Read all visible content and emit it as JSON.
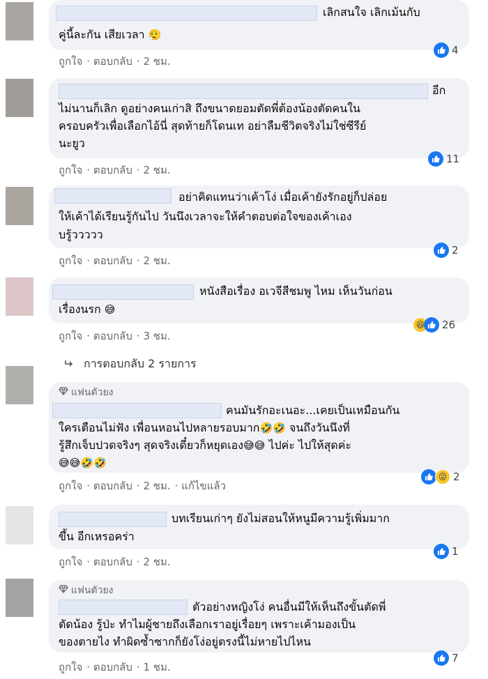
{
  "comments": [
    {
      "lines": [
        "เลิกสนใจ เลิกเม้นกับ",
        "คู่นี้ละกัน เสียเวลา"
      ],
      "emoji": "😮‍💨",
      "actions": [
        "ถูกใจ",
        "ตอบกลับ",
        "2 ชม."
      ],
      "reactions_count": "4"
    },
    {
      "lines": [
        "อีก",
        "ไม่นานก็เลิก ดูอย่างคนเก่าสิ ถึงขนาดยอมตัดพี่ต้องน้องตัดคนใน",
        "ครอบครัวเพื่อเลือกไอ้นี่ สุดท้ายก็โดนเท อย่าลืมชีวิตจริงไม่ใช่ซีรีย์",
        "นะยูว"
      ],
      "actions": [
        "ถูกใจ",
        "ตอบกลับ",
        "2 ชม."
      ],
      "reactions_count": "11"
    },
    {
      "lines": [
        "อย่าคิดแทนว่าเค้าโง่ เมื่อเค้ายังรักอยู่ก็ปล่อย",
        "ให้เค้าได้เรียนรู้กันไป วันนึงเวลาจะให้คำตอบต่อใจของเค้าเอง",
        "บรู้ววววว"
      ],
      "actions": [
        "ถูกใจ",
        "ตอบกลับ",
        "2 ชม."
      ],
      "reactions_count": "2"
    },
    {
      "lines": [
        "หนังสือเรื่อง อเวจีสีชมพู ไหม เห็นวันก่อน",
        "เรื่องนรก"
      ],
      "emoji": "😅",
      "actions": [
        "ถูกใจ",
        "ตอบกลับ",
        "3 ชม."
      ],
      "reactions_count": "26"
    },
    {
      "fan_label": "แฟนตัวยง",
      "lines": [
        "คนมันรักอะเนอะ...เคยเป็นเหมือนกัน",
        "ใครเตือนไม่ฟัง เพื่อนหอนไปหลายรอบมาก",
        "จนถึงวันนึงที่",
        "รู้สึกเจ็บปวดจริงๆ สุดจริงเดี๋ยวก็หยุดเอง",
        "ไปค่ะ ไปให้สุดค่ะ"
      ],
      "emojis_a": "🤣🤣",
      "emojis_b": "😅😅",
      "emojis_c": "😅😅🤣🤣",
      "actions": [
        "ถูกใจ",
        "ตอบกลับ",
        "2 ชม.",
        "แก้ไขแล้ว"
      ],
      "reactions_count": "2"
    },
    {
      "lines": [
        "บทเรียนเก่าๆ ยังไม่สอนให้หนูมีความรู้เพิ่มมาก",
        "ขึ้น อีกเหรอคร่า"
      ],
      "actions": [
        "ถูกใจ",
        "ตอบกลับ",
        "2 ชม."
      ],
      "reactions_count": "1"
    },
    {
      "fan_label": "แฟนตัวยง",
      "lines": [
        "ตัวอย่างหญิงโง่ คนอื่นมีให้เห็นถึงขั้นตัดพี่",
        "ตัดน้อง รู้ป่ะ ทำไมผู้ชายถึงเลือกเราอยู่เรื่อยๆ เพราะเค้ามองเป็น",
        "ของตายไง ทำผิดซ้ำซากก็ยังโง่อยู่ตรงนี้ไม่หายไปไหน"
      ],
      "actions": [
        "ถูกใจ",
        "ตอบกลับ",
        "1 ชม."
      ],
      "reactions_count": "7"
    }
  ],
  "replies_link": "การตอบกลับ 2 รายการ",
  "colors": {
    "like": "#1877f2",
    "bubble": "#f0f2f5",
    "meta": "#65676b"
  },
  "icons": [
    "like-icon",
    "haha-icon",
    "diamond-icon",
    "reply-arrow-icon"
  ]
}
